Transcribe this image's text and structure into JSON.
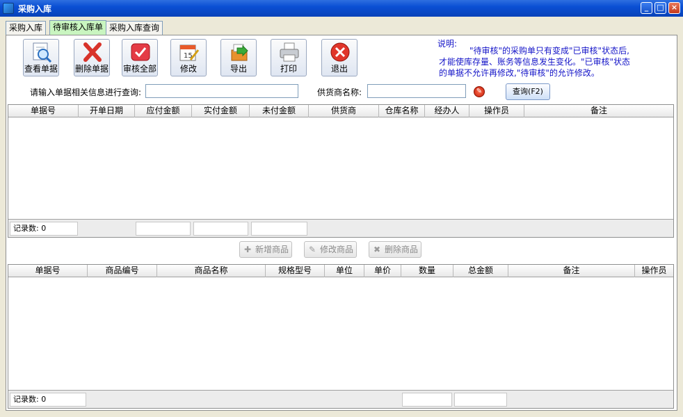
{
  "window": {
    "title": "采购入库",
    "minimize": "_",
    "maximize": "□",
    "close": "×"
  },
  "tabs": [
    {
      "label": "采购入库",
      "active": false
    },
    {
      "label": "待审核入库单",
      "active": true
    },
    {
      "label": "采购入库查询",
      "active": false
    }
  ],
  "toolbar": {
    "view": "查看单据",
    "delete": "删除单据",
    "approve_all": "审核全部",
    "edit": "修改",
    "export": "导出",
    "print": "打印",
    "exit": "退出"
  },
  "note": {
    "title": "说明:",
    "line1": "\"待审核\"的采购单只有变成\"已审核\"状态后,",
    "line2": "才能使库存量、账务等信息发生变化。\"已审核\"状态",
    "line3": "的单据不允许再修改,\"待审核\"的允许修改。"
  },
  "search": {
    "query_label": "请输入单据相关信息进行查询:",
    "query_value": "",
    "supplier_label": "供货商名称:",
    "supplier_value": "",
    "query_button": "查询(F2)"
  },
  "grid1": {
    "columns": [
      "单据号",
      "开单日期",
      "应付金额",
      "实付金额",
      "未付金额",
      "供货商",
      "仓库名称",
      "经办人",
      "操作员",
      "备注"
    ],
    "record_count": "记录数: 0"
  },
  "mid_buttons": {
    "add": "新增商品",
    "edit": "修改商品",
    "delete": "删除商品"
  },
  "grid2": {
    "columns": [
      "单据号",
      "商品编号",
      "商品名称",
      "规格型号",
      "单位",
      "单价",
      "数量",
      "总金额",
      "备注",
      "操作员"
    ],
    "record_count": "记录数: 0"
  },
  "colors": {
    "titlebar": "#0a4fd4",
    "note_text": "#1414c8",
    "active_tab": "#c9f5c0"
  }
}
